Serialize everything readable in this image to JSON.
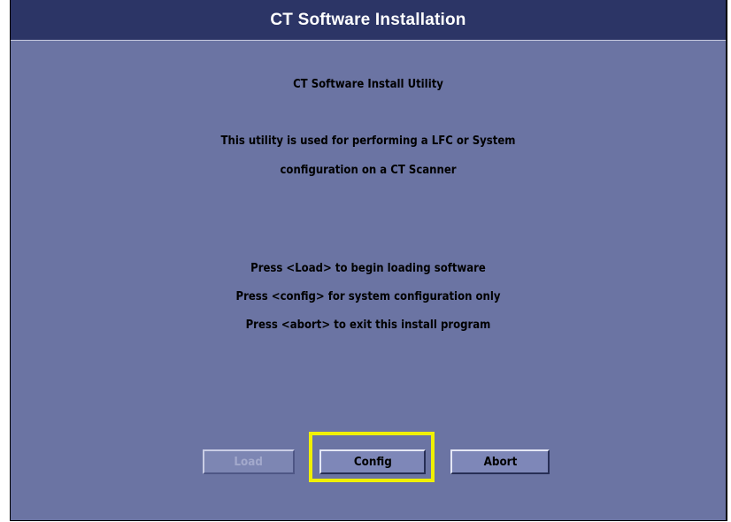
{
  "window": {
    "title": "CT Software Installation"
  },
  "content": {
    "heading": "CT Software Install Utility",
    "description_line1": "This utility is used for performing a LFC or System",
    "description_line2": "configuration on a CT Scanner",
    "instruction_load": "Press <Load> to begin loading software",
    "instruction_config": "Press <config> for system configuration only",
    "instruction_abort": "Press <abort> to exit this install program"
  },
  "buttons": {
    "load_label": "Load",
    "config_label": "Config",
    "abort_label": "Abort"
  },
  "colors": {
    "title_bar": "#2c3566",
    "window_background": "#6b74a3",
    "button_face": "#7e87b8",
    "highlight": "#f0f000"
  }
}
